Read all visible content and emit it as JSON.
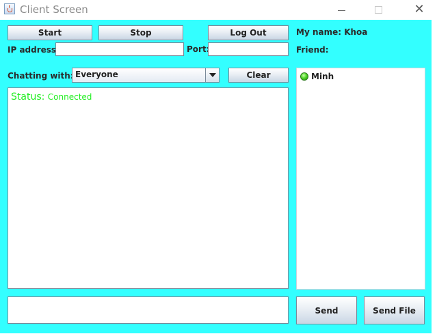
{
  "window": {
    "title": "Client Screen",
    "controls": {
      "minimize": "minimize-icon",
      "maximize": "maximize-icon",
      "close": "close-icon",
      "close_glyph": "✕"
    }
  },
  "colors": {
    "client_background": "#33ffff",
    "status_text": "#22ee22",
    "online_indicator": "#4ccf2a"
  },
  "toolbar": {
    "start_label": "Start",
    "stop_label": "Stop",
    "logout_label": "Log Out"
  },
  "connection": {
    "ip_label": "IP address:",
    "ip_value": "",
    "port_label": "Port:",
    "port_value": ""
  },
  "profile": {
    "my_name_label": "My name: Khoa",
    "friend_label": "Friend:"
  },
  "chat": {
    "chatting_with_label": "Chatting with:",
    "recipient_selected": "Everyone",
    "clear_label": "Clear",
    "status_key": "Status:",
    "status_value": "Connected",
    "message_value": ""
  },
  "friends": [
    {
      "name": "Minh",
      "status_icon": "online-status-icon"
    }
  ],
  "actions": {
    "send_label": "Send",
    "send_file_label": "Send File"
  }
}
